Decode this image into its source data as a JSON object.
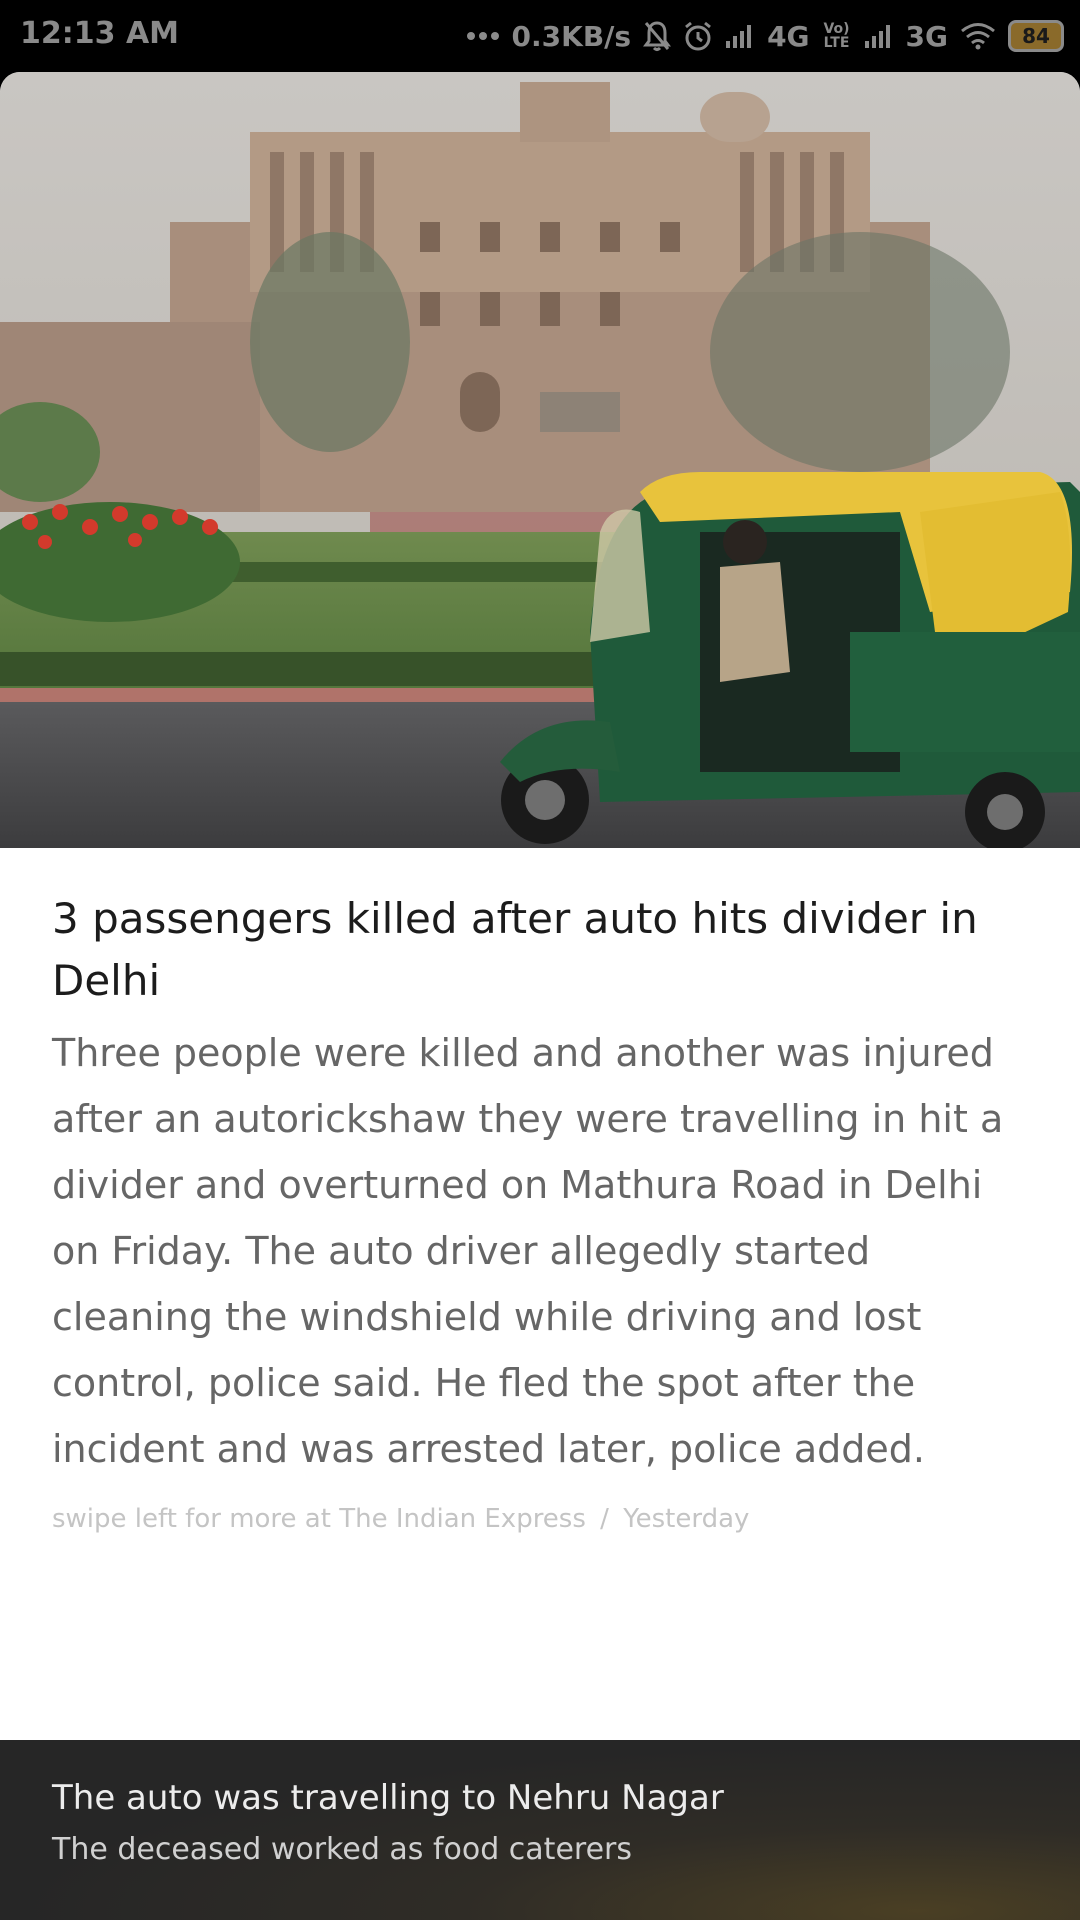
{
  "status_bar": {
    "time": "12:13 AM",
    "more_icon": "more-dots-icon",
    "network_speed": "0.3KB/s",
    "icons": [
      "bell-muted-icon",
      "alarm-icon",
      "signal-icon",
      "wifi-icon"
    ],
    "network_1": "4G",
    "volte": "Vo) LTE",
    "network_2": "3G",
    "battery": "84"
  },
  "article": {
    "hero_image": "auto-rickshaw-delhi-photo",
    "headline": "3 passengers killed after auto hits divider in Delhi",
    "body": "Three people were killed and another was injured after an autorickshaw they were travelling in hit a divider and overturned on Mathura Road in Delhi on Friday. The auto driver allegedly started cleaning the windshield while driving and lost control, police said. He fled the spot after the incident and was arrested later, police added.",
    "source_prefix": "swipe left for more at",
    "source_name": "The Indian Express",
    "separator": "/",
    "time": "Yesterday"
  },
  "footer": {
    "title": "The auto was travelling to Nehru Nagar",
    "subtitle": "The deceased worked as food caterers"
  },
  "colors": {
    "card_bg": "#ffffff",
    "headline": "#1c1c1c",
    "body": "#666666",
    "source": "#c4c4c4",
    "footer_bg": "#262626"
  }
}
